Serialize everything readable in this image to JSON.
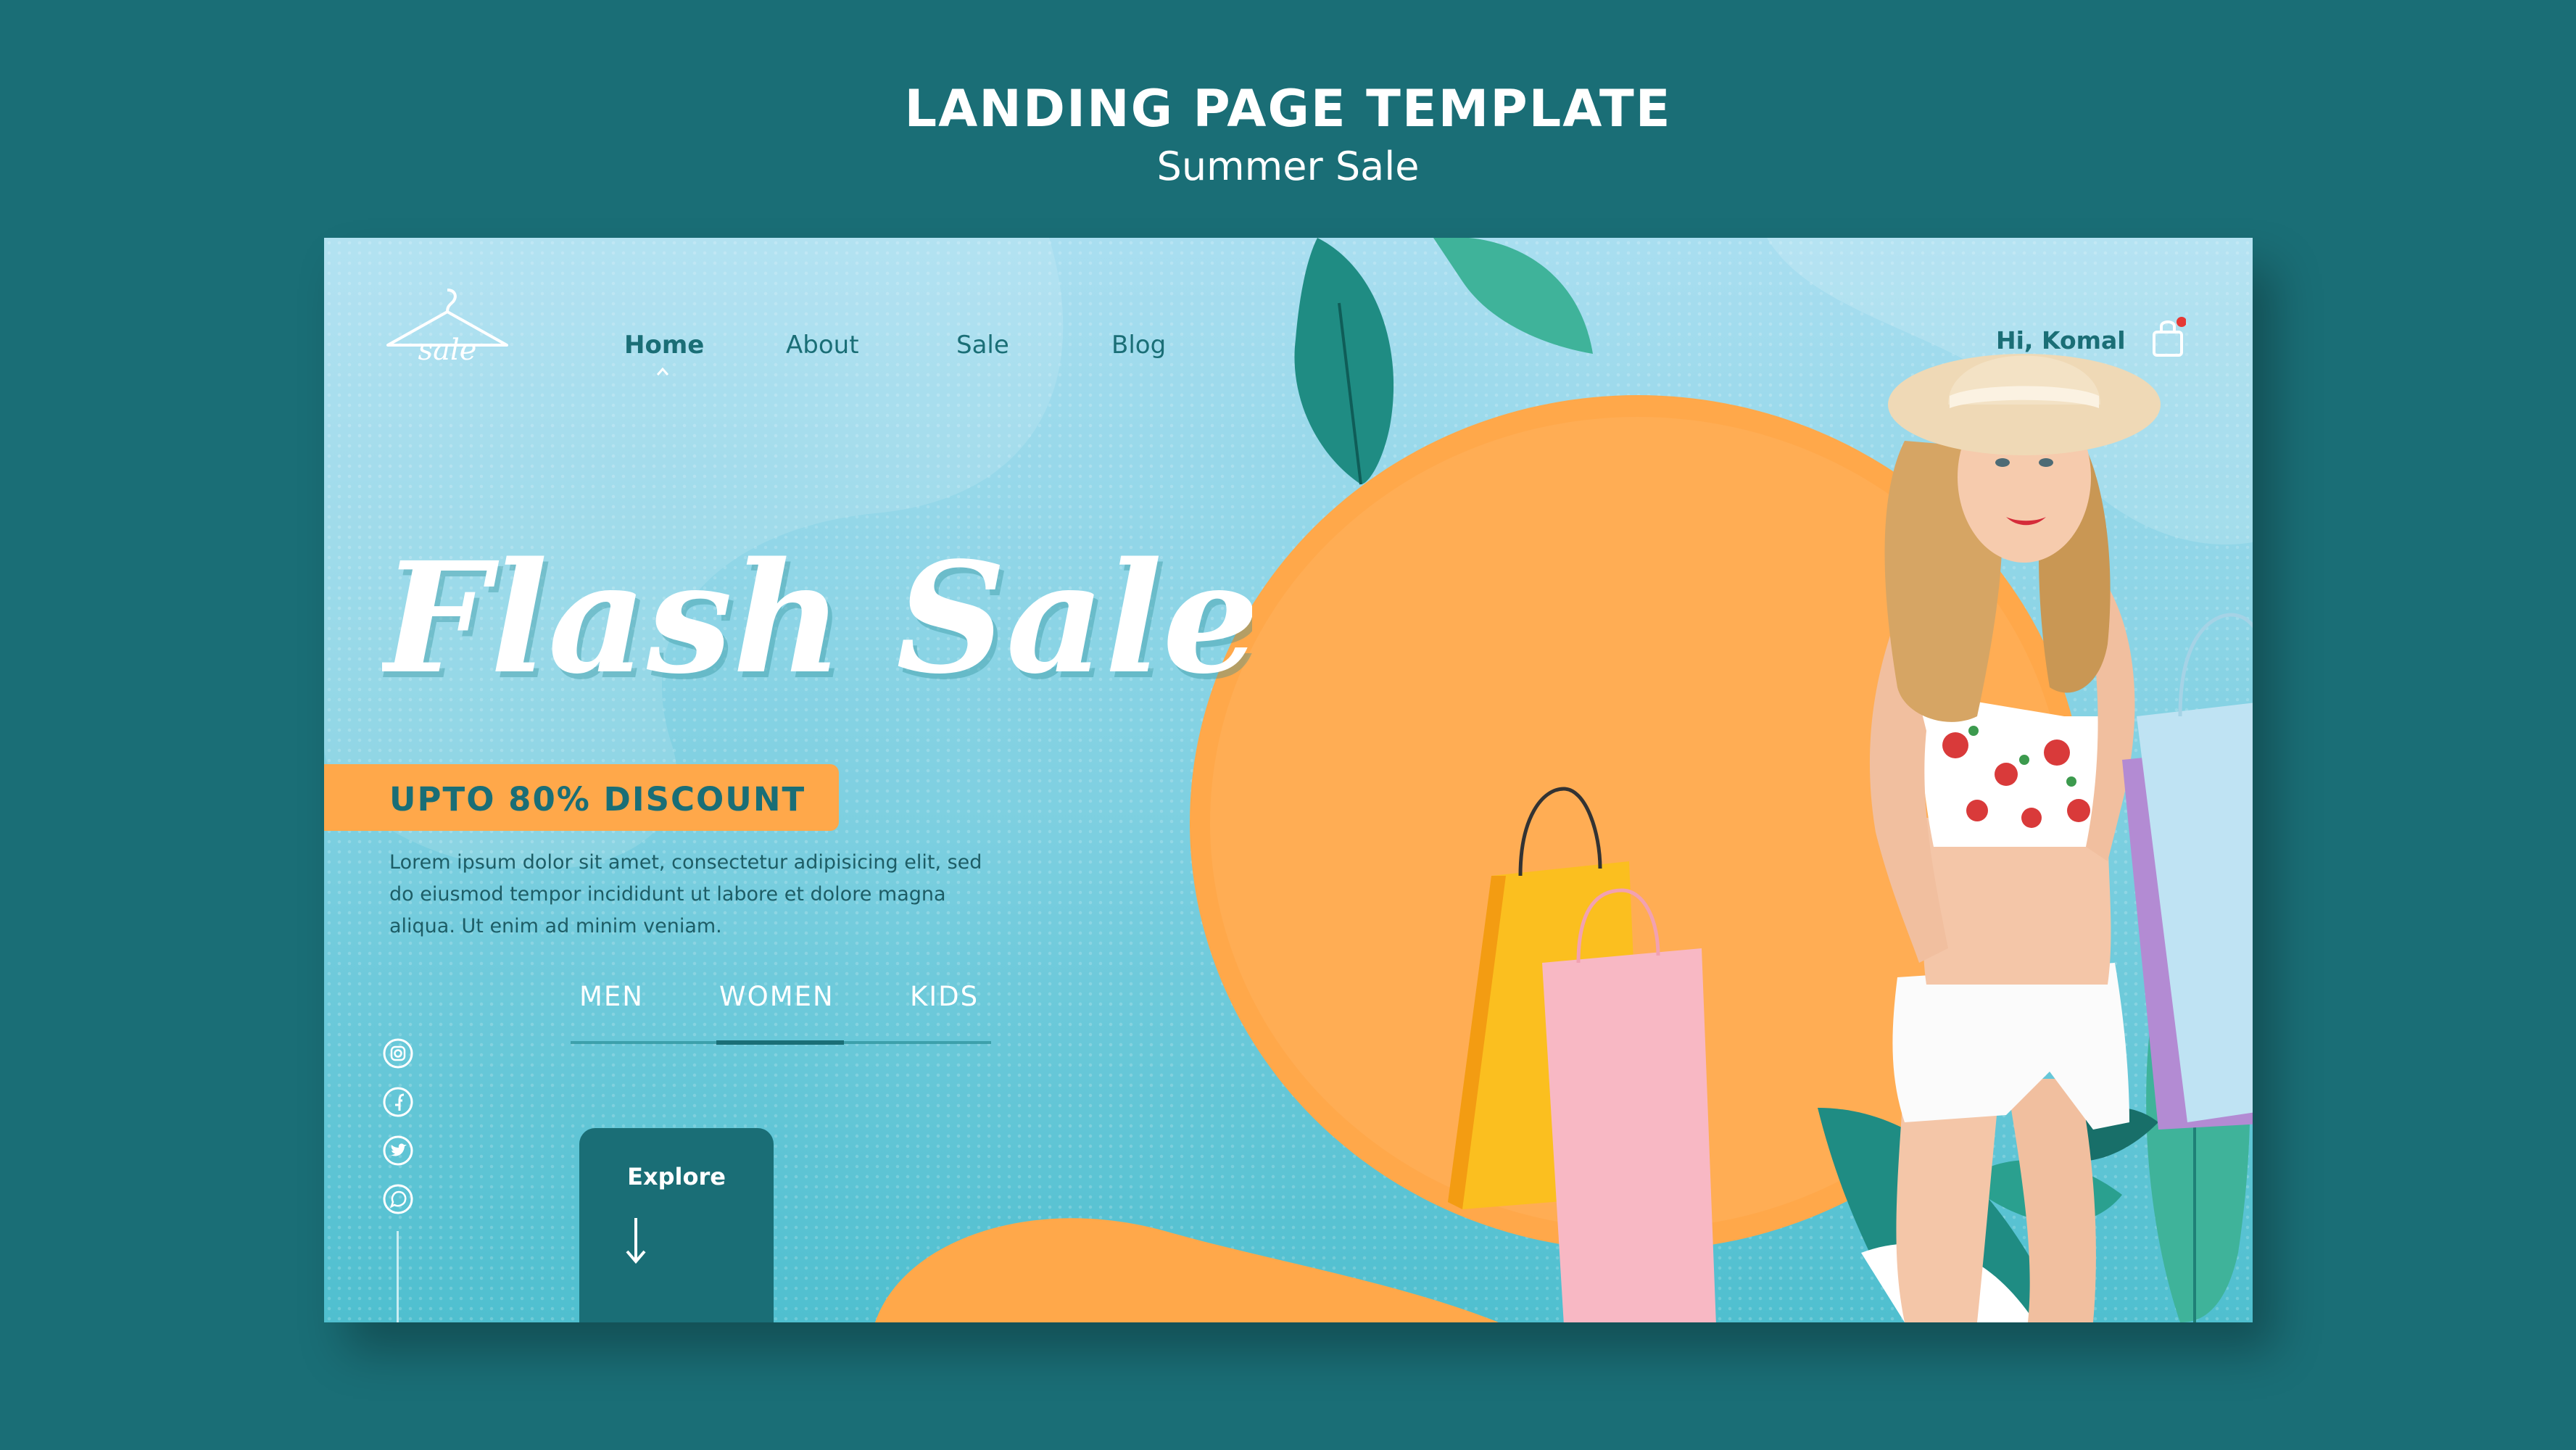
{
  "page_heading": {
    "title": "LANDING PAGE TEMPLATE",
    "subtitle": "Summer Sale"
  },
  "header": {
    "logo_text": "sale",
    "nav": [
      {
        "label": "Home",
        "active": true
      },
      {
        "label": "About",
        "active": false
      },
      {
        "label": "Sale",
        "active": false
      },
      {
        "label": "Blog",
        "active": false
      }
    ],
    "greeting": "Hi, Komal",
    "cart_icon": "shopping-bag-icon",
    "cart_badge_color": "#e53935"
  },
  "hero": {
    "headline": "Flash Sale",
    "discount": "UPTO 80% DISCOUNT",
    "description_lines": [
      "Lorem ipsum dolor sit amet, consectetur adipisicing elit, sed",
      "do eiusmod tempor incididunt ut labore et dolore magna",
      "aliqua. Ut enim ad minim veniam."
    ],
    "categories": [
      {
        "label": "MEN",
        "active": false
      },
      {
        "label": "WOMEN",
        "active": true
      },
      {
        "label": "KIDS",
        "active": false
      }
    ],
    "explore_label": "Explore",
    "explore_icon": "arrow-down-icon"
  },
  "social_icons": [
    "instagram-icon",
    "facebook-icon",
    "twitter-icon",
    "whatsapp-icon"
  ],
  "colors": {
    "background": "#1a6e76",
    "accent_orange": "#ffa84a",
    "primary_teal": "#1a6e76",
    "sky": "#a9def0"
  }
}
